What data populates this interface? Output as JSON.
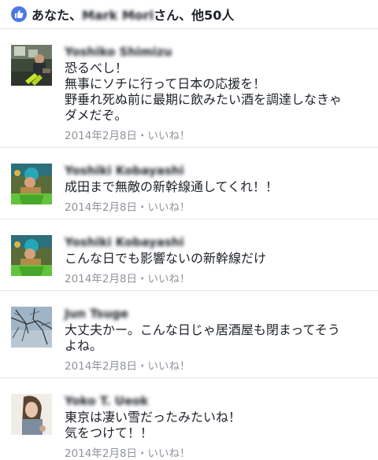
{
  "likes_bar": {
    "prefix": "あなた、",
    "names": "Mark Mori",
    "suffix": "さん、他50人"
  },
  "comments": [
    {
      "author": "Yoshiko Shimizu",
      "lines": [
        "恐るべし！",
        "無事にソチに行って日本の応援を！",
        "野垂れ死ぬ前に最期に飲みたい酒を調達しなきゃ",
        "ダメだぞ。"
      ],
      "date": "2014年2月8日",
      "sep": "・",
      "like": "いいね！"
    },
    {
      "author": "Yoshiki Kobayashi",
      "lines": [
        "成田まで無敵の新幹線通してくれ！！"
      ],
      "date": "2014年2月8日",
      "sep": "・",
      "like": "いいね！"
    },
    {
      "author": "Yoshiki Kobayashi",
      "lines": [
        "こんな日でも影響ないの新幹線だけ"
      ],
      "date": "2014年2月8日",
      "sep": "・",
      "like": "いいね！"
    },
    {
      "author": "Jun Tsuge",
      "lines": [
        "大丈夫かー。こんな日じゃ居酒屋も閉まってそう",
        "よね。"
      ],
      "date": "2014年2月8日",
      "sep": "・",
      "like": "いいね！"
    },
    {
      "author": "Yoko T. Ueok",
      "lines": [
        "東京は凄い雪だったみたいね！",
        "気をつけて！！"
      ],
      "date": "2014年2月8日",
      "sep": "・",
      "like": "いいね！"
    }
  ]
}
